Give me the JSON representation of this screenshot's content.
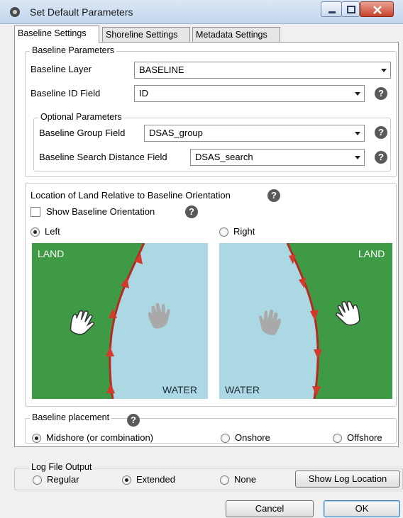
{
  "window": {
    "title": "Set Default Parameters"
  },
  "tabs": [
    "Baseline Settings",
    "Shoreline Settings",
    "Metadata Settings"
  ],
  "baseline_parameters": {
    "legend": "Baseline Parameters",
    "layer_label": "Baseline Layer",
    "layer_value": "BASELINE",
    "id_label": "Baseline ID Field",
    "id_value": "ID",
    "optional": {
      "legend": "Optional Parameters",
      "group_label": "Baseline Group Field",
      "group_value": "DSAS_group",
      "search_label": "Baseline Search Distance Field",
      "search_value": "DSAS_search"
    }
  },
  "location": {
    "title": "Location of Land Relative to Baseline Orientation",
    "show_orientation_label": "Show Baseline Orientation",
    "left_label": "Left",
    "right_label": "Right",
    "selected": "Left",
    "left_panel": {
      "land": "LAND",
      "water": "WATER"
    },
    "right_panel": {
      "land": "LAND",
      "water": "WATER"
    }
  },
  "placement": {
    "legend": "Baseline placement",
    "options": [
      "Midshore (or combination)",
      "Onshore",
      "Offshore"
    ],
    "selected": "Midshore (or combination)"
  },
  "log": {
    "legend": "Log File Output",
    "options": [
      "Regular",
      "Extended",
      "None"
    ],
    "selected": "Extended",
    "show_location_label": "Show Log Location"
  },
  "buttons": {
    "cancel": "Cancel",
    "ok": "OK"
  },
  "help_glyph": "?",
  "colors": {
    "land": "#3f9a45",
    "water": "#abd8e3",
    "baseline": "#b82a20",
    "titlebar": "#c3d6ee"
  }
}
